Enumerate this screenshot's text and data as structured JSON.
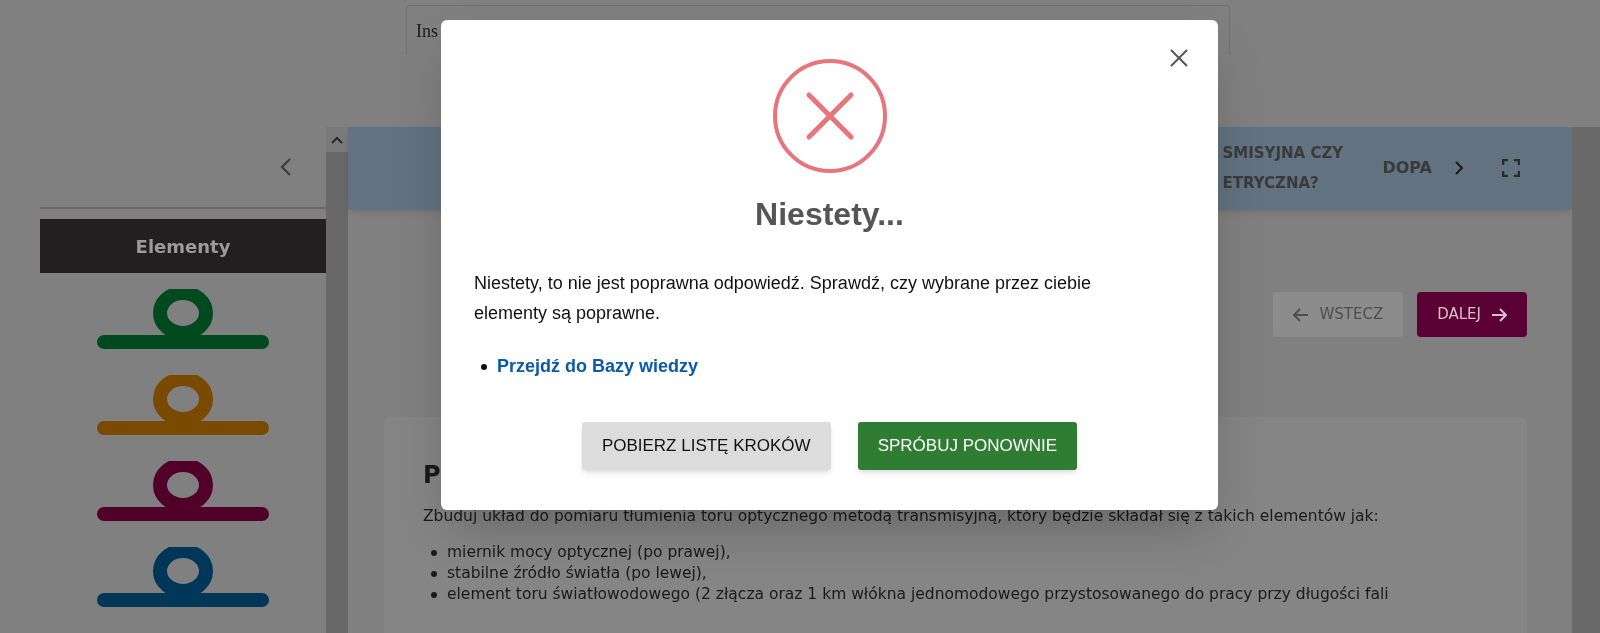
{
  "background_page": {
    "top_field": {
      "text": "Ins"
    },
    "sidebar": {
      "header": "Elementy",
      "elements": [
        {
          "color": "#004a1d"
        },
        {
          "color": "#7a4a00"
        },
        {
          "color": "#51002a"
        },
        {
          "color": "#003658"
        }
      ]
    },
    "banner": {
      "title_lines": [
        "SMISYJNA CZY",
        "ETRYCZNA?"
      ],
      "next_label": "DOPA"
    },
    "nav": [
      {
        "label": "WSTECZ",
        "kind": "back",
        "disabled": true
      },
      {
        "label": "DALEJ",
        "kind": "next",
        "disabled": false
      }
    ],
    "task": {
      "heading": "P",
      "intro": "Zbuduj układ do pomiaru tłumienia toru optycznego metodą transmisyjną, który będzie składał się z takich elementów jak:",
      "items": [
        "miernik mocy optycznej (po prawej),",
        "stabilne źródło światła (po lewej),",
        "element toru światłowodowego (2 złącza oraz 1 km włókna jednomodowego przystosowanego do pracy przy długości fali"
      ]
    }
  },
  "dialog": {
    "title": "Niestety...",
    "message": "Niestety, to nie jest poprawna odpowiedź. Sprawdź, czy wybrane przez ciebie elementy są poprawne.",
    "links": [
      "Przejdź do Bazy wiedzy"
    ],
    "buttons": [
      {
        "label": "POBIERZ LISTĘ KROKÓW",
        "kind": "secondary"
      },
      {
        "label": "SPRÓBUJ PONOWNIE",
        "kind": "primary"
      }
    ]
  }
}
